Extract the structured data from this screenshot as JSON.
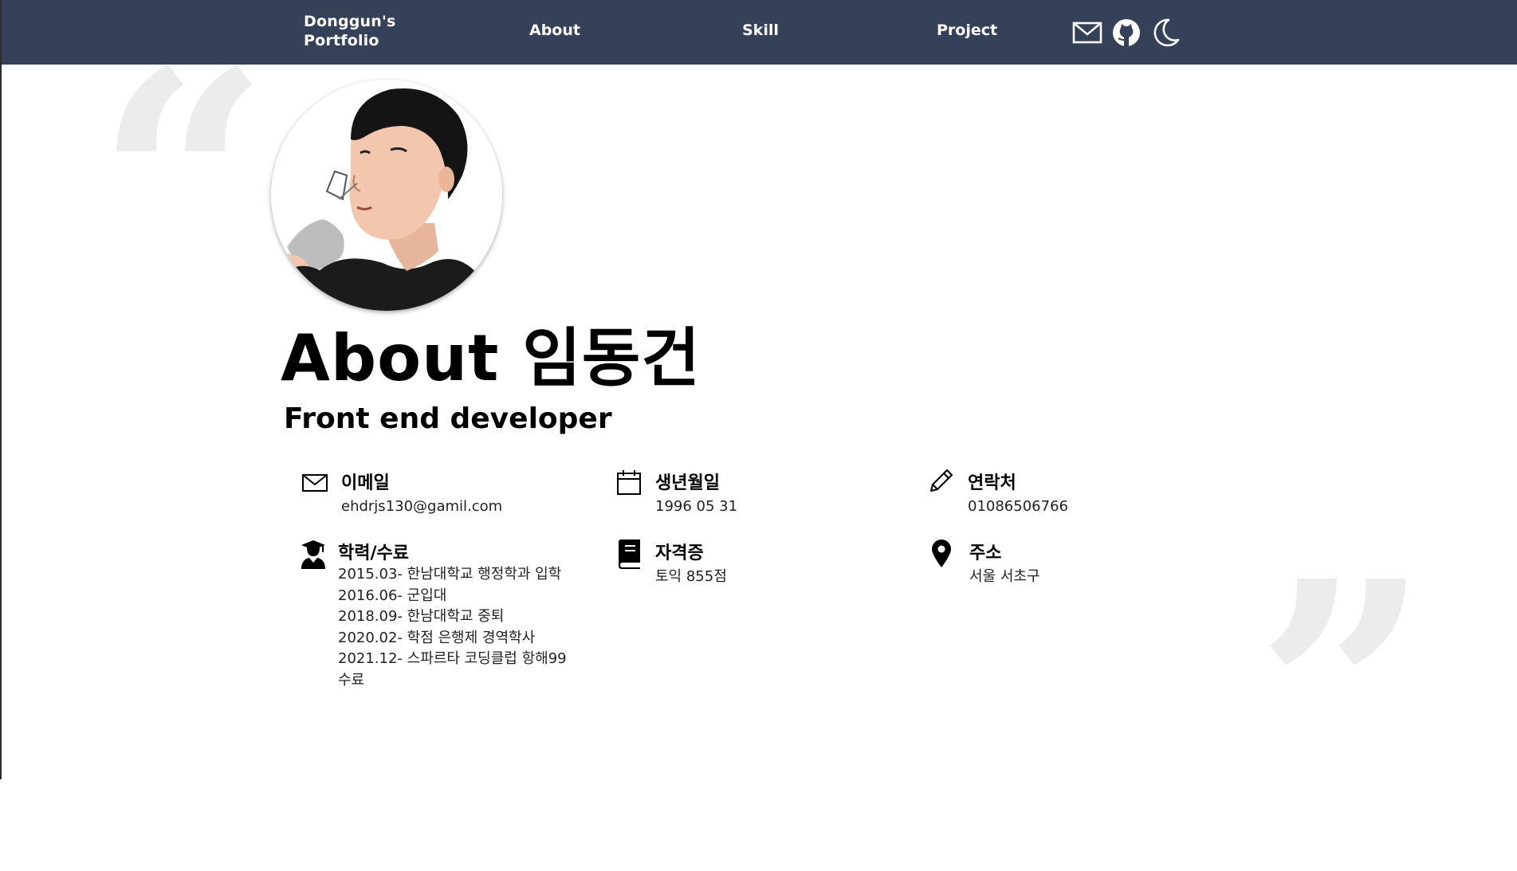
{
  "nav": {
    "brand": [
      "Donggun's",
      "Portfolio"
    ],
    "links": [
      "About",
      "Skill",
      "Project"
    ],
    "icons": [
      "mail-icon",
      "github-icon",
      "moon-icon"
    ],
    "bg_color": "#354159"
  },
  "about": {
    "title": "About 임동건",
    "subtitle": "Front end developer"
  },
  "info": {
    "email": {
      "label": "이메일",
      "value": "ehdrjs130@gamil.com",
      "icon": "mail-icon"
    },
    "birth": {
      "label": "생년월일",
      "value": "1996 05 31",
      "icon": "calendar-icon"
    },
    "contact": {
      "label": "연락처",
      "value": "01086506766",
      "icon": "pencil-icon"
    },
    "education": {
      "label": "학력/수료",
      "icon": "graduate-icon",
      "items": [
        "2015.03- 한남대학교 행정학과 입학",
        "2016.06- 군입대",
        "2018.09- 한남대학교 중퇴",
        "2020.02- 학점 은행제 경역학사",
        "2021.12- 스파르타 코딩클럽 항해99",
        "수료"
      ]
    },
    "license": {
      "label": "자격증",
      "value": "토익 855점",
      "icon": "book-icon"
    },
    "address": {
      "label": "주소",
      "value": "서울 서초구",
      "icon": "location-pin-icon"
    }
  }
}
